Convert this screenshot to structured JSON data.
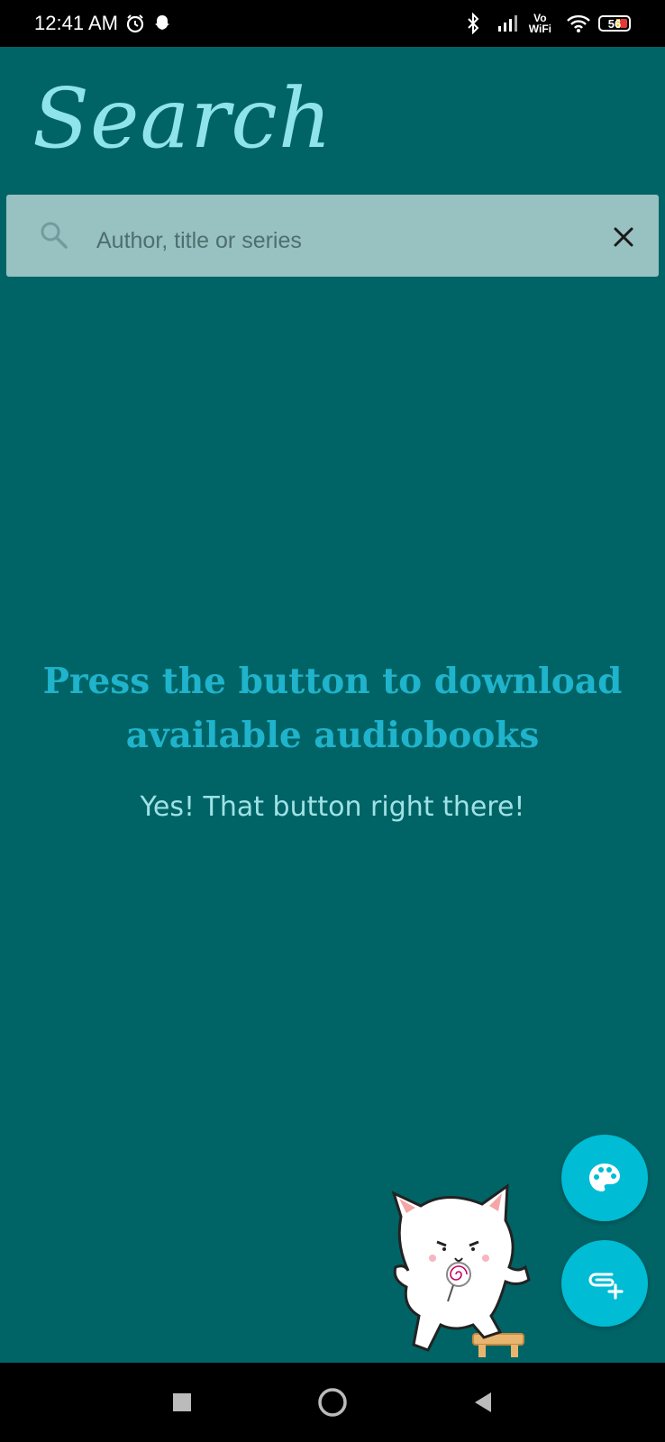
{
  "status_bar": {
    "time": "12:41 AM",
    "vowifi_top": "Vo",
    "vowifi_bottom": "WiFi",
    "battery": "56"
  },
  "header": {
    "title": "Search"
  },
  "search": {
    "placeholder": "Author, title or series",
    "value": ""
  },
  "empty_state": {
    "heading": "Press the button to download available audiobooks",
    "subtext": "Yes! That button right there!"
  },
  "fabs": [
    {
      "icon": "palette-icon"
    },
    {
      "icon": "add-library-icon"
    }
  ],
  "colors": {
    "background": "#006466",
    "accent": "#00bcd4",
    "heading": "#1fb3cc",
    "search_bg": "#98c1c1"
  }
}
